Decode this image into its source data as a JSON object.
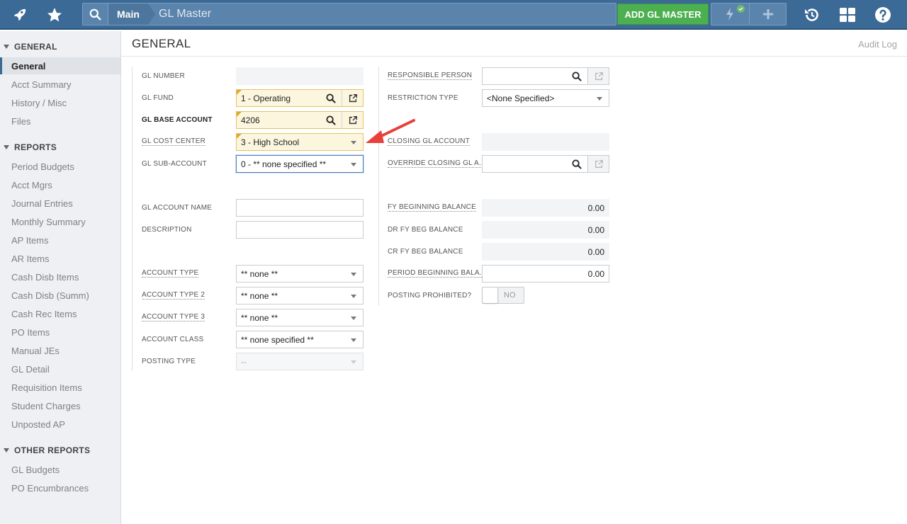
{
  "topbar": {
    "breadcrumb_main": "Main",
    "breadcrumb_current": "GL Master",
    "add_button": "ADD GL MASTER",
    "bar_color": "#3b6a96",
    "add_color": "#4cb050"
  },
  "sidebar": {
    "sections": [
      {
        "title": "GENERAL",
        "items": [
          "General",
          "Acct Summary",
          "History / Misc",
          "Files"
        ]
      },
      {
        "title": "REPORTS",
        "items": [
          "Period Budgets",
          "Acct Mgrs",
          "Journal Entries",
          "Monthly Summary",
          "AP Items",
          "AR Items",
          "Cash Disb Items",
          "Cash Disb (Summ)",
          "Cash Rec Items",
          "PO Items",
          "Manual JEs",
          "GL Detail",
          "Requisition Items",
          "Student Charges",
          "Unposted AP"
        ]
      },
      {
        "title": "OTHER REPORTS",
        "items": [
          "GL Budgets",
          "PO Encumbrances"
        ]
      }
    ],
    "active_item": "General"
  },
  "main": {
    "title": "GENERAL",
    "audit_log": "Audit Log"
  },
  "form_left": {
    "gl_number": {
      "label": "GL NUMBER",
      "value": ""
    },
    "gl_fund": {
      "label": "GL FUND",
      "value": "1 - Operating"
    },
    "gl_base_account": {
      "label": "GL BASE ACCOUNT",
      "value": "4206"
    },
    "gl_cost_center": {
      "label": "GL COST CENTER",
      "value": "3 - High School"
    },
    "gl_sub_account": {
      "label": "GL SUB-ACCOUNT",
      "value": "0 - ** none specified **"
    },
    "gl_account_name": {
      "label": "GL ACCOUNT NAME",
      "value": ""
    },
    "description": {
      "label": "DESCRIPTION",
      "value": ""
    },
    "account_type": {
      "label": "ACCOUNT TYPE",
      "value": "** none **"
    },
    "account_type_2": {
      "label": "ACCOUNT TYPE 2",
      "value": "** none **"
    },
    "account_type_3": {
      "label": "ACCOUNT TYPE 3",
      "value": "** none **"
    },
    "account_class": {
      "label": "ACCOUNT CLASS",
      "value": "** none specified **"
    },
    "posting_type": {
      "label": "POSTING TYPE",
      "value": "--"
    }
  },
  "form_right": {
    "responsible_person": {
      "label": "RESPONSIBLE PERSON",
      "value": ""
    },
    "restriction_type": {
      "label": "RESTRICTION TYPE",
      "value": "<None Specified>"
    },
    "closing_gl_account": {
      "label": "CLOSING GL ACCOUNT",
      "value": ""
    },
    "override_closing": {
      "label": "OVERRIDE CLOSING GL A...",
      "value": ""
    },
    "fy_beginning_balance": {
      "label": "FY BEGINNING BALANCE",
      "value": "0.00"
    },
    "dr_fy_beg_balance": {
      "label": "DR FY BEG BALANCE",
      "value": "0.00"
    },
    "cr_fy_beg_balance": {
      "label": "CR FY BEG BALANCE",
      "value": "0.00"
    },
    "period_beginning_balance": {
      "label": "PERIOD BEGINNING BALA...",
      "value": "0.00"
    },
    "posting_prohibited": {
      "label": "POSTING PROHIBITED?",
      "value": "NO"
    }
  },
  "annotation": {
    "arrow_color": "#e8403a"
  }
}
